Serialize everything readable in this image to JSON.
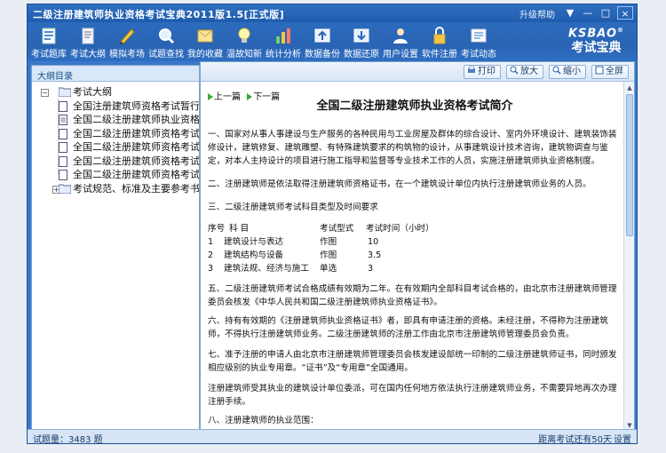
{
  "window": {
    "title": "二级注册建筑师执业资格考试宝典2011版1.5[正式版]",
    "help": "升级帮助",
    "controls": [
      "▼",
      "—",
      "□",
      "×"
    ]
  },
  "toolbar": {
    "items": [
      {
        "label": "考试题库",
        "icon": "question-bank-icon"
      },
      {
        "label": "考试大纲",
        "icon": "syllabus-icon"
      },
      {
        "label": "模拟考场",
        "icon": "mock-exam-icon"
      },
      {
        "label": "试题查找",
        "icon": "search-icon"
      },
      {
        "label": "我的收藏",
        "icon": "favorites-icon"
      },
      {
        "label": "温故知新",
        "icon": "review-icon"
      },
      {
        "label": "统计分析",
        "icon": "statistics-icon"
      },
      {
        "label": "数据备份",
        "icon": "backup-icon"
      },
      {
        "label": "数据还原",
        "icon": "restore-icon"
      },
      {
        "label": "用户设置",
        "icon": "user-settings-icon"
      },
      {
        "label": "软件注册",
        "icon": "register-icon"
      },
      {
        "label": "考试动态",
        "icon": "news-icon"
      }
    ],
    "brand_top": "KSBAO",
    "brand_reg": "®",
    "brand_bottom": "考试宝典"
  },
  "left_panel": {
    "header": "大纲目录",
    "tree": [
      {
        "label": "考试大纲",
        "type": "root"
      },
      {
        "label": "全国注册建筑师资格考试暂行规",
        "type": "child"
      },
      {
        "label": "全国二级注册建筑师执业资格考",
        "type": "child-selected"
      },
      {
        "label": "全国二级注册建筑师资格考试大",
        "type": "child"
      },
      {
        "label": "全国二级注册建筑师资格考试报名时",
        "type": "child"
      },
      {
        "label": "全国二级注册建筑师资格考试时",
        "type": "child"
      },
      {
        "label": "全国二级注册建筑师资格考试时间与",
        "type": "child"
      },
      {
        "label": "考试规范、标准及主要参考书目",
        "type": "child"
      }
    ]
  },
  "right_toolbar": {
    "print": "打印",
    "zoom_in": "放大",
    "zoom_out": "缩小",
    "fullscreen": "全屏"
  },
  "document": {
    "prev": "上一篇",
    "next": "下一篇",
    "title": "全国二级注册建筑师执业资格考试简介",
    "p1": "一、国家对从事人事建设与生产服务的各种民用与工业房屋及群体的综合设计、室内外环境设计、建筑装饰装修设计，建筑修复、建筑雕塑、有特殊建筑要求的构筑物的设计，从事建筑设计技术咨询，建筑物调查与鉴定，对本人主持设计的项目进行施工指导和监督等专业技术工作的人员，实施注册建筑师执业资格制度。",
    "p2": "二、注册建筑师是依法取得注册建筑师资格证书，在一个建筑设计单位内执行注册建筑师业务的人员。",
    "p3": "三、二级注册建筑师考试科目类型及时间要求",
    "table": {
      "headers": [
        "序号",
        "科  目",
        "考试型式",
        "考试时间（小时）"
      ],
      "rows": [
        [
          "1",
          "建筑设计与表达",
          "作图",
          "10"
        ],
        [
          "2",
          "建筑结构与设备",
          "作图",
          "3.5"
        ],
        [
          "3",
          "建筑法规、经济与施工",
          "单选",
          "3"
        ]
      ]
    },
    "p5": "五、二级注册建筑师考试合格成绩有效期为二年。在有效期内全部科目考试合格的，由北京市注册建筑师管理委员会核发《中华人民共和国二级注册建筑师执业资格证书》。",
    "p6": "六、持有有效期的《注册建筑师执业资格证书》者，即具有申请注册的资格。未经注册，不得称为注册建筑师，不得执行注册建筑师业务。二级注册建筑师的注册工作由北京市注册建筑师管理委员会负责。",
    "p7": "七、准予注册的申请人由北京市注册建筑师管理委员会核发建设部统一印制的二级注册建筑师证书，同时颁发相应级别的执业专用章。“证书”及“专用章”全国通用。",
    "p8": "注册建筑师受其执业的建筑设计单位委派，可在国内任何地方依法执行注册建筑师业务，不需要异地再次办理注册手续。",
    "p9": "八、注册建筑师的执业范围："
  },
  "status": {
    "question_count": "试题量：3483 题",
    "countdown": "距离考试还有50天",
    "settings": "设置"
  },
  "colors": {
    "window_blue": "#3a78c9",
    "toolbar_blue": "#2a64b3",
    "accent_green": "#39a839"
  }
}
